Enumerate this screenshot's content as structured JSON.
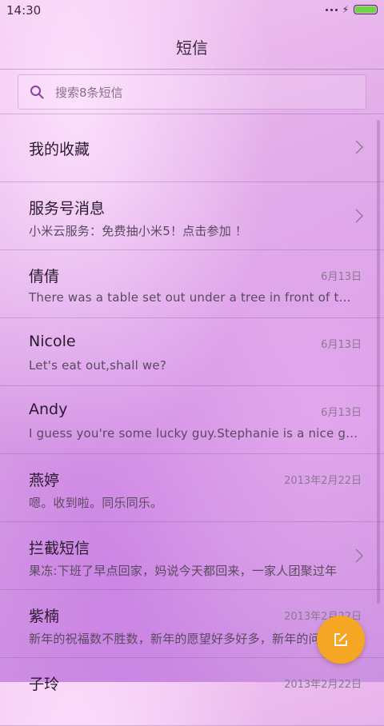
{
  "status_bar": {
    "time": "14:30",
    "battery_level_percent": 100,
    "battery_color": "#6fd24a",
    "icons": [
      "signal-dots-icon",
      "charging-bolt-icon",
      "battery-icon"
    ]
  },
  "header": {
    "title": "短信"
  },
  "search": {
    "placeholder": "搜索8条短信",
    "icon": "search-icon"
  },
  "conversations": [
    {
      "name": "我的收藏",
      "preview": "",
      "date": "",
      "chevron": true
    },
    {
      "name": "服务号消息",
      "preview": "小米云服务：免费抽小米5！点击参加 ！",
      "date": "",
      "chevron": true
    },
    {
      "name": "倩倩",
      "preview": "There was a table set out under a tree in front of the house",
      "date": "6月13日",
      "chevron": false
    },
    {
      "name": "Nicole",
      "preview": "Let's eat out,shall we?",
      "date": "6月13日",
      "chevron": false
    },
    {
      "name": "Andy",
      "preview": "I guess you're some lucky guy.Stephanie is a nice girl.",
      "date": "6月13日",
      "chevron": false
    },
    {
      "name": "燕婷",
      "preview": "嗯。收到啦。同乐同乐。",
      "date": "2013年2月22日",
      "chevron": false
    },
    {
      "name": "拦截短信",
      "preview": "果冻:下班了早点回家，妈说今天都回来，一家人团聚过年",
      "date": "",
      "chevron": true
    },
    {
      "name": "紫楠",
      "preview": "新年的祝福数不胜数，新年的愿望好多好多，新年的问候",
      "date": "2013年2月22日",
      "chevron": false
    },
    {
      "name": "子玲",
      "preview": "",
      "date": "2013年2月22日",
      "chevron": false
    }
  ],
  "fab": {
    "icon": "compose-icon",
    "color": "#f5a623"
  }
}
